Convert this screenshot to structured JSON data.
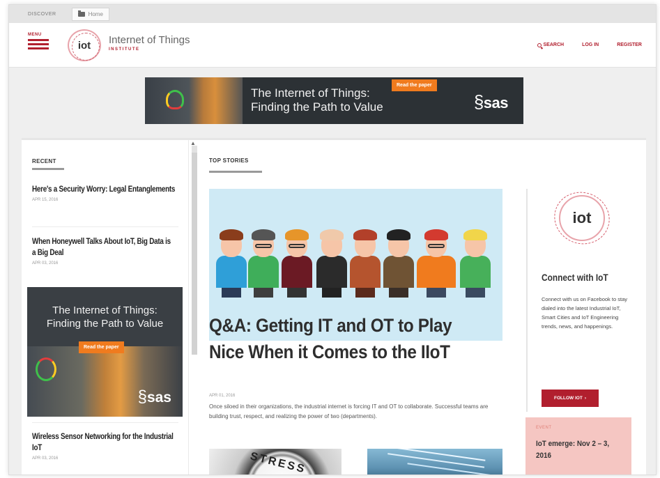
{
  "topbar": {
    "discover_label": "DISCOVER",
    "home_tab": "Home"
  },
  "header": {
    "menu_label": "MENU",
    "logo_text": "iot",
    "brand_name": "Internet of Things",
    "brand_sub": "INSTITUTE",
    "nav": {
      "search": "SEARCH",
      "login": "LOG IN",
      "register": "REGISTER"
    }
  },
  "banner_ad": {
    "title_line1": "The Internet of Things:",
    "title_line2": "Finding the Path to Value",
    "cta": "Read the paper",
    "sponsor": "sas"
  },
  "recent": {
    "heading": "RECENT",
    "items": [
      {
        "title": "Here's a Security Worry: Legal Entanglements",
        "date": "APR 15, 2016"
      },
      {
        "title": "When Honeywell Talks About IoT, Big Data is a Big Deal",
        "date": "APR 03, 2016"
      },
      {
        "title": "Wireless Sensor Networking for the Industrial IoT",
        "date": "APR 03, 2016"
      }
    ],
    "ad": {
      "title_line1": "The Internet of Things:",
      "title_line2": "Finding the Path to Value",
      "cta": "Read the paper",
      "sponsor": "sas"
    }
  },
  "top_stories": {
    "heading": "TOP STORIES",
    "lead": {
      "title": "Q&A: Getting IT and OT to Play Nice When it Comes to the IIoT",
      "date": "APR 01, 2016",
      "description": "Once siloed in their organizations, the industrial internet is forcing IT and OT to collaborate. Successful teams are building trust, respect, and realizing the power of two (departments)."
    },
    "thumb1_text": "STRESS"
  },
  "sidebar_right": {
    "logo_text": "iot",
    "title": "Connect with IoT",
    "description": "Connect with us on Facebook to stay dialed into the latest Industrial IoT, Smart Cities and IoT Engineering trends, news, and happenings.",
    "follow_button": "FOLLOW IOT",
    "event": {
      "label": "EVENT",
      "title": "IoT emerge: Nov 2 – 3, 2016"
    }
  },
  "colors": {
    "accent": "#b11f2e",
    "event_bg": "#f5c6c2",
    "cta_orange": "#f07b1e"
  }
}
